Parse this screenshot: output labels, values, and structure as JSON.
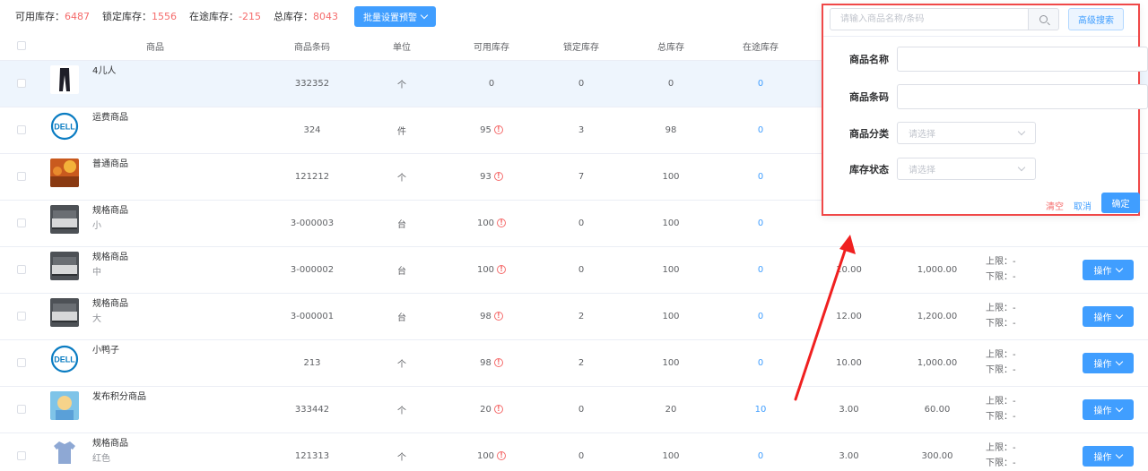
{
  "topbar": {
    "stats": [
      {
        "label": "可用库存：",
        "value": "6487"
      },
      {
        "label": "锁定库存：",
        "value": "1556"
      },
      {
        "label": "在途库存：",
        "value": "-215"
      },
      {
        "label": "总库存：",
        "value": "8043"
      }
    ],
    "batch_label": "批量设置预警"
  },
  "table": {
    "headers": [
      "商品",
      "商品条码",
      "单位",
      "可用库存",
      "锁定库存",
      "总库存",
      "在途库存"
    ],
    "limit_upper": "上限：-",
    "limit_lower": "下限：-",
    "op_label": "操作",
    "rows": [
      {
        "name": "4儿人",
        "spec": "",
        "barcode": "332352",
        "unit": "个",
        "available": "0",
        "locked": "0",
        "total": "0",
        "transit": "0",
        "cost": "",
        "amount": "",
        "thumb": "pants",
        "warn": false
      },
      {
        "name": "运费商品",
        "spec": "",
        "barcode": "324",
        "unit": "件",
        "available": "95",
        "locked": "3",
        "total": "98",
        "transit": "0",
        "cost": "",
        "amount": "",
        "thumb": "dell",
        "warn": true
      },
      {
        "name": "普通商品",
        "spec": "",
        "barcode": "121212",
        "unit": "个",
        "available": "93",
        "locked": "7",
        "total": "100",
        "transit": "0",
        "cost": "",
        "amount": "",
        "thumb": "autumn",
        "warn": true
      },
      {
        "name": "规格商品",
        "spec": "小",
        "barcode": "3-000003",
        "unit": "台",
        "available": "100",
        "locked": "0",
        "total": "100",
        "transit": "0",
        "cost": "",
        "amount": "",
        "thumb": "bed",
        "warn": true
      },
      {
        "name": "规格商品",
        "spec": "中",
        "barcode": "3-000002",
        "unit": "台",
        "available": "100",
        "locked": "0",
        "total": "100",
        "transit": "0",
        "cost": "10.00",
        "amount": "1,000.00",
        "thumb": "bed",
        "warn": true
      },
      {
        "name": "规格商品",
        "spec": "大",
        "barcode": "3-000001",
        "unit": "台",
        "available": "98",
        "locked": "2",
        "total": "100",
        "transit": "0",
        "cost": "12.00",
        "amount": "1,200.00",
        "thumb": "bed",
        "warn": true
      },
      {
        "name": "小鸭子",
        "spec": "",
        "barcode": "213",
        "unit": "个",
        "available": "98",
        "locked": "2",
        "total": "100",
        "transit": "0",
        "cost": "10.00",
        "amount": "1,000.00",
        "thumb": "dell",
        "warn": true
      },
      {
        "name": "发布积分商品",
        "spec": "",
        "barcode": "333442",
        "unit": "个",
        "available": "20",
        "locked": "0",
        "total": "20",
        "transit": "10",
        "cost": "3.00",
        "amount": "60.00",
        "thumb": "kid",
        "warn": true
      },
      {
        "name": "规格商品",
        "spec": "红色",
        "barcode": "121313",
        "unit": "个",
        "available": "100",
        "locked": "0",
        "total": "100",
        "transit": "0",
        "cost": "3.00",
        "amount": "300.00",
        "thumb": "shirt",
        "warn": true
      }
    ]
  },
  "search_panel": {
    "placeholder": "请输入商品名称/条码",
    "advanced_label": "高级搜索",
    "fields": {
      "name_label": "商品名称",
      "barcode_label": "商品条码",
      "category_label": "商品分类",
      "category_placeholder": "请选择",
      "status_label": "库存状态",
      "status_placeholder": "请选择"
    },
    "clear_label": "清空",
    "cancel_label": "取消",
    "ok_label": "确定"
  },
  "colors": {
    "accent": "#409eff",
    "danger": "#f56c6c",
    "highlight_border": "#f04848",
    "row_highlight": "#eef5fd"
  },
  "dell_logo_text": "DELL"
}
